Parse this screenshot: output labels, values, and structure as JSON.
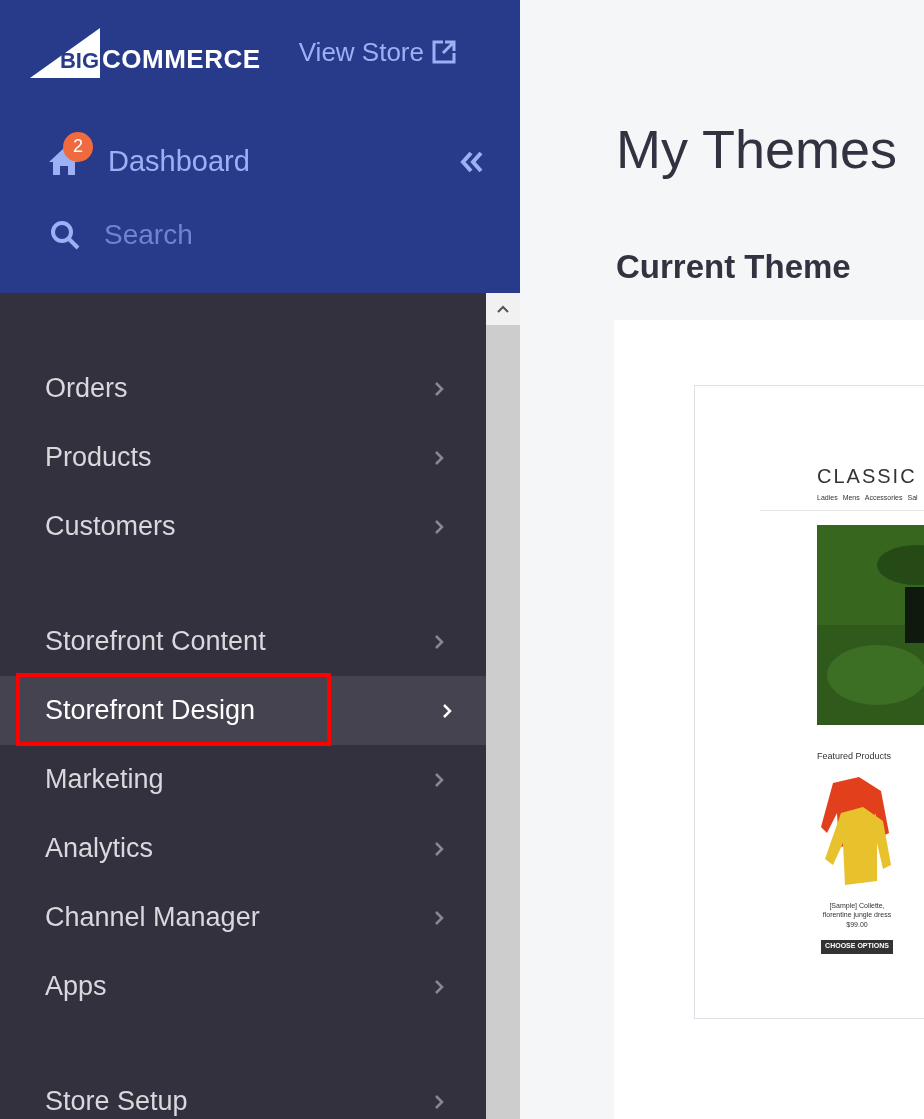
{
  "header": {
    "logo_mark": "BIG",
    "logo_text": "COMMERCE",
    "view_store": "View Store",
    "dashboard": {
      "label": "Dashboard",
      "badge": "2"
    },
    "search": {
      "placeholder": "Search"
    }
  },
  "sidebar": {
    "groups": [
      [
        {
          "label": "Orders",
          "selected": false,
          "highlighted": false
        },
        {
          "label": "Products",
          "selected": false,
          "highlighted": false
        },
        {
          "label": "Customers",
          "selected": false,
          "highlighted": false
        }
      ],
      [
        {
          "label": "Storefront Content",
          "selected": false,
          "highlighted": false
        },
        {
          "label": "Storefront Design",
          "selected": true,
          "highlighted": true
        },
        {
          "label": "Marketing",
          "selected": false,
          "highlighted": false
        },
        {
          "label": "Analytics",
          "selected": false,
          "highlighted": false
        },
        {
          "label": "Channel Manager",
          "selected": false,
          "highlighted": false
        },
        {
          "label": "Apps",
          "selected": false,
          "highlighted": false
        }
      ],
      [
        {
          "label": "Store Setup",
          "selected": false,
          "highlighted": false
        }
      ]
    ]
  },
  "main": {
    "title": "My Themes",
    "section": "Current Theme",
    "preview": {
      "store_name": "CLASSIC",
      "nav": [
        "Ladies",
        "Mens",
        "Accessories",
        "Sal"
      ],
      "featured_title": "Featured Products",
      "products": [
        {
          "name": "[Sample] Collette, florentine jungle dress",
          "price": "$99.00",
          "button": "CHOOSE OPTIONS"
        }
      ]
    }
  }
}
